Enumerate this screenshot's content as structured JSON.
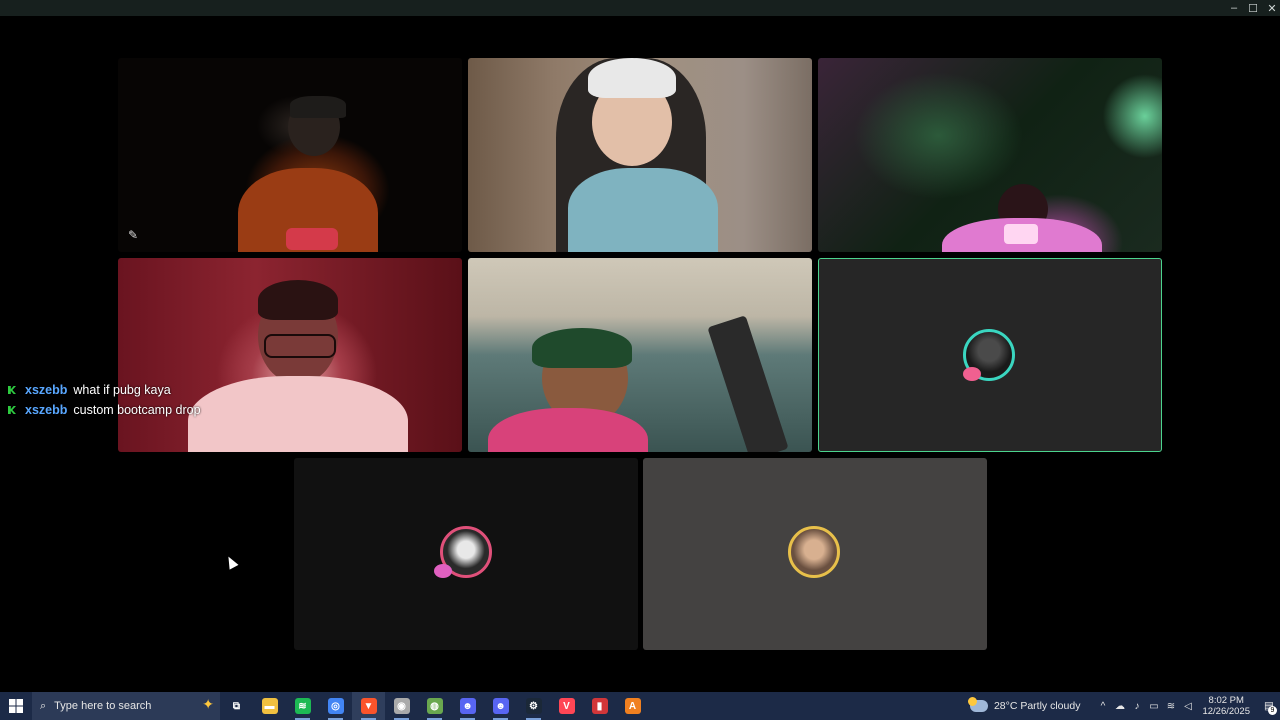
{
  "window": {
    "controls": {
      "minimize": "–",
      "maximize": "☐",
      "close": "✕"
    }
  },
  "chat": [
    {
      "user": "xszebb",
      "message": "what if pubg kaya"
    },
    {
      "user": "xszebb",
      "message": "custom bootcamp drop"
    }
  ],
  "taskbar": {
    "search_placeholder": "Type here to search",
    "apps": [
      {
        "icon": "task-view-icon",
        "glyph": "⧉"
      },
      {
        "icon": "file-explorer-icon",
        "glyph": "▬"
      },
      {
        "icon": "spotify-icon",
        "glyph": "≋"
      },
      {
        "icon": "chrome-icon",
        "glyph": "◎"
      },
      {
        "icon": "brave-icon",
        "glyph": "▼"
      },
      {
        "icon": "obs-icon",
        "glyph": "◉"
      },
      {
        "icon": "app-globe-icon",
        "glyph": "◍"
      },
      {
        "icon": "discord-icon",
        "glyph": "☻"
      },
      {
        "icon": "discord-alt-icon",
        "glyph": "☻"
      },
      {
        "icon": "steam-icon",
        "glyph": "⚙"
      },
      {
        "icon": "valorant-icon",
        "glyph": "V"
      },
      {
        "icon": "riot-icon",
        "glyph": "▮"
      },
      {
        "icon": "app-orange-icon",
        "glyph": "A"
      }
    ],
    "weather": {
      "temp": "28°C",
      "condition": "Partly cloudy"
    },
    "clock": {
      "time": "8:02 PM",
      "date": "12/26/2025"
    },
    "notification_count": "9"
  },
  "colors": {
    "active_speaker_border": "#4cd48e",
    "chat_username": "#59a7ff",
    "taskbar": "#1c2a47"
  }
}
